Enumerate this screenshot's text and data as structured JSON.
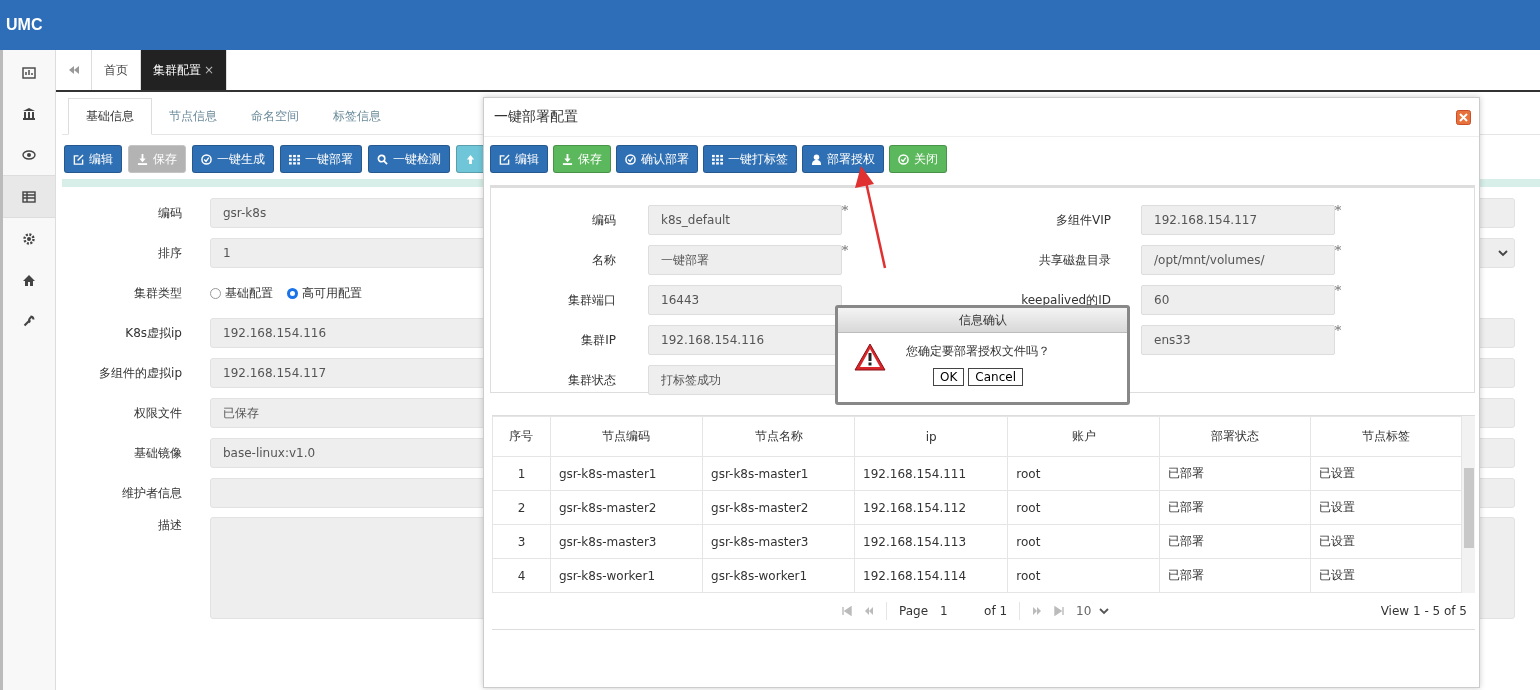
{
  "header": {
    "logo": "UMC"
  },
  "sidebar": {
    "items": [
      {
        "selected": false
      },
      {
        "selected": false
      },
      {
        "selected": false
      },
      {
        "selected": true
      },
      {
        "selected": false
      },
      {
        "selected": false
      },
      {
        "selected": false
      }
    ]
  },
  "page_tabs": [
    {
      "label": "首页",
      "selected": false
    },
    {
      "label": "集群配置",
      "selected": true,
      "close": "×"
    }
  ],
  "inner_tabs": [
    {
      "label": "基础信息",
      "selected": true
    },
    {
      "label": "节点信息",
      "selected": false
    },
    {
      "label": "命名空间",
      "selected": false
    },
    {
      "label": "标签信息",
      "selected": false
    }
  ],
  "toolbar": [
    {
      "label": "编辑",
      "kind": "primary",
      "disabled": false
    },
    {
      "label": "保存",
      "kind": "default",
      "disabled": true
    },
    {
      "label": "一键生成",
      "kind": "primary",
      "disabled": false
    },
    {
      "label": "一键部署",
      "kind": "primary",
      "disabled": false
    },
    {
      "label": "一键检测",
      "kind": "primary",
      "disabled": false
    },
    {
      "kind": "info",
      "disabled": false
    }
  ],
  "form": {
    "fields": [
      {
        "label": "编码",
        "kind": "text",
        "value": "gsr-k8s"
      },
      {
        "label": "排序",
        "kind": "select",
        "value": "1"
      },
      {
        "label": "集群类型",
        "kind": "radio",
        "options": [
          {
            "label": "基础配置",
            "selected": false
          },
          {
            "label": "高可用配置",
            "selected": true
          }
        ]
      },
      {
        "label": "K8s虚拟ip",
        "kind": "text",
        "value": "192.168.154.116"
      },
      {
        "label": "多组件的虚拟ip",
        "kind": "text",
        "value": "192.168.154.117"
      },
      {
        "label": "权限文件",
        "kind": "text",
        "value": "已保存"
      },
      {
        "label": "基础镜像",
        "kind": "text",
        "value": "base-linux:v1.0"
      },
      {
        "label": "维护者信息",
        "kind": "text"
      },
      {
        "label": "描述",
        "kind": "textarea"
      }
    ]
  },
  "modal": {
    "title": "一键部署配置",
    "toolbar": [
      {
        "label": "编辑",
        "kind": "primary"
      },
      {
        "label": "保存",
        "kind": "success"
      },
      {
        "label": "确认部署",
        "kind": "primary"
      },
      {
        "label": "一键打标签",
        "kind": "primary"
      },
      {
        "label": "部署授权",
        "kind": "primary"
      },
      {
        "label": "关闭",
        "kind": "success"
      }
    ],
    "left_fields": [
      {
        "label": "编码",
        "value": "k8s_default",
        "required": true
      },
      {
        "label": "名称",
        "value": "一键部署",
        "required": true
      },
      {
        "label": "集群端口",
        "value": "16443",
        "required": false
      },
      {
        "label": "集群IP",
        "value": "192.168.154.116",
        "required": false
      },
      {
        "label": "集群状态",
        "value": "打标签成功",
        "required": false
      }
    ],
    "right_fields": [
      {
        "label": "多组件VIP",
        "value": "192.168.154.117",
        "required": true
      },
      {
        "label": "共享磁盘目录",
        "value": "/opt/mnt/volumes/",
        "required": true
      },
      {
        "label": "keepalived的ID",
        "value": "60",
        "required": true
      },
      {
        "value": "ens33",
        "required": true
      }
    ],
    "table": {
      "columns": [
        "序号",
        "节点编码",
        "节点名称",
        "ip",
        "账户",
        "部署状态",
        "节点标签"
      ],
      "rows": [
        {
          "cells": [
            "1",
            "gsr-k8s-master1",
            "gsr-k8s-master1",
            "192.168.154.111",
            "root",
            "已部署",
            "已设置"
          ]
        },
        {
          "cells": [
            "2",
            "gsr-k8s-master2",
            "gsr-k8s-master2",
            "192.168.154.112",
            "root",
            "已部署",
            "已设置"
          ]
        },
        {
          "cells": [
            "3",
            "gsr-k8s-master3",
            "gsr-k8s-master3",
            "192.168.154.113",
            "root",
            "已部署",
            "已设置"
          ]
        },
        {
          "cells": [
            "4",
            "gsr-k8s-worker1",
            "gsr-k8s-worker1",
            "192.168.154.114",
            "root",
            "已部署",
            "已设置"
          ]
        }
      ]
    },
    "pager": {
      "page_label": "Page",
      "page": "1",
      "of": "of 1",
      "page_size": "10",
      "summary": "View 1 - 5 of 5"
    }
  },
  "dialog": {
    "title": "信息确认",
    "message": "您确定要部署授权文件吗？",
    "buttons": [
      "OK",
      "Cancel"
    ]
  }
}
